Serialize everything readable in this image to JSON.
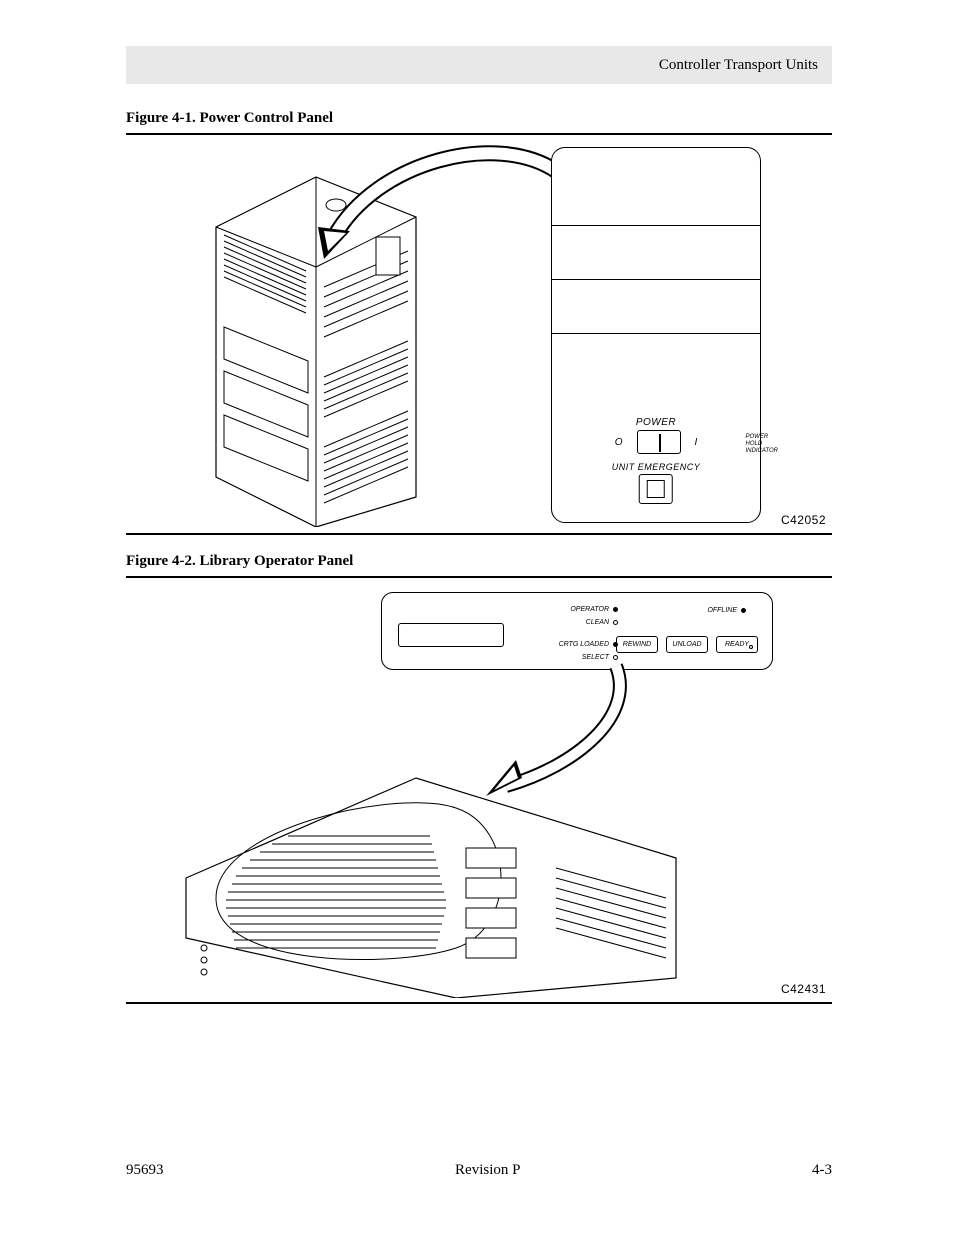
{
  "header": {
    "section_title": "Controller Transport Units"
  },
  "figure1": {
    "caption": "Figure 4-1. Power Control Panel",
    "ref": "C42052",
    "labels": {
      "power": "POWER",
      "zero": "O",
      "one": "I",
      "side_text": "POWER\nHOLD\nINDICATOR",
      "unit_emergency": "UNIT EMERGENCY"
    }
  },
  "figure2": {
    "caption": "Figure 4-2. Library Operator Panel",
    "ref": "C42431",
    "labels": {
      "operator": "OPERATOR",
      "clean": "CLEAN",
      "crtg_loaded": "CRTG LOADED",
      "select": "SELECT",
      "offline": "OFFLINE",
      "rewind": "REWIND",
      "unload": "UNLOAD",
      "ready": "READY"
    }
  },
  "footer": {
    "left": "95693",
    "center": "Revision P",
    "right": "4-3"
  }
}
